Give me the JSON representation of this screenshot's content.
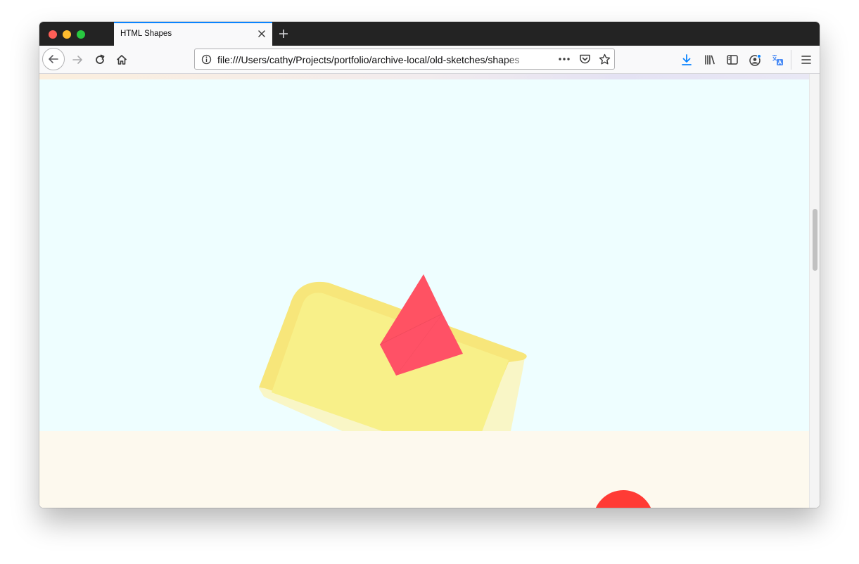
{
  "window": {
    "tab_title": "HTML Shapes",
    "url": "file:///Users/cathy/Projects/portfolio/archive-local/old-sketches/shapes"
  },
  "toolbar_icons": [
    "back-arrow-icon",
    "forward-arrow-icon",
    "reload-icon",
    "home-icon",
    "site-info-icon",
    "page-actions-icon",
    "pocket-icon",
    "bookmark-star-icon",
    "downloads-icon",
    "library-icon",
    "sidebar-icon",
    "account-icon",
    "translate-icon",
    "menu-icon"
  ],
  "colors": {
    "tab_accent": "#0a84ff",
    "downloads_accent": "#0a84ff",
    "sky": "#eefeff",
    "floor": "#fdf9ee",
    "card_face": "#f8f089",
    "card_edge": "#f7e67a",
    "card_side": "#f9f6c6",
    "pyramid": "#ff5263",
    "ball": "#ff3b35"
  }
}
